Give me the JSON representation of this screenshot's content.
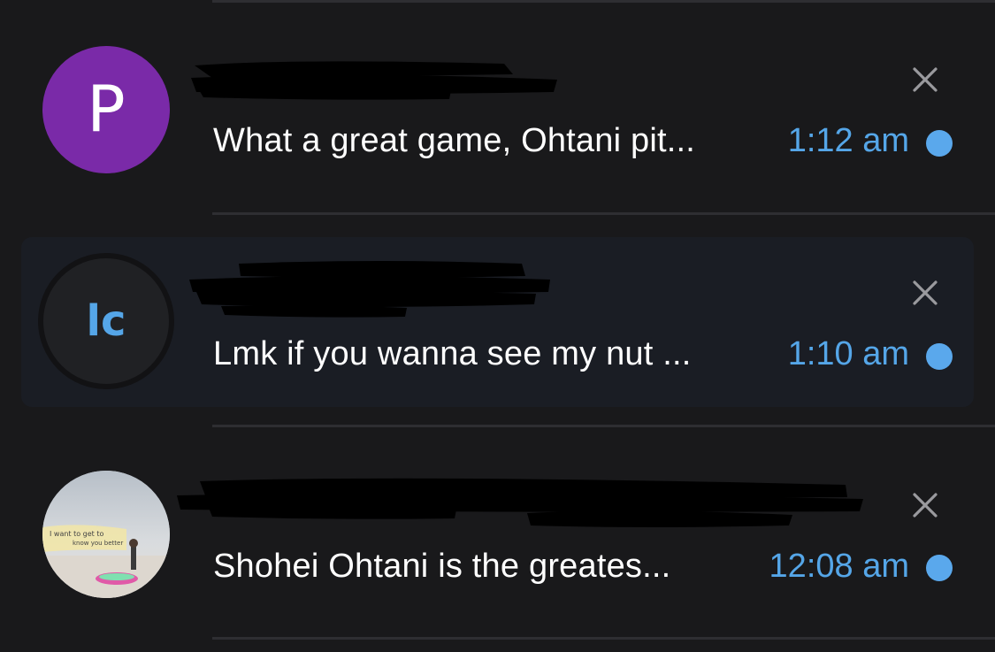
{
  "colors": {
    "background": "#19191b",
    "selected_row": "#1a1d24",
    "accent_blue": "#55a6e8",
    "unread_dot": "#5aa8ec",
    "divider": "#2e2e32",
    "close_icon": "#9a9a9e"
  },
  "conversations": [
    {
      "avatar_letter": "P",
      "avatar_color": "#7a2aa8",
      "name_redacted": true,
      "message": "What a great game, Ohtani pit...",
      "time": "1:12 am",
      "unread": true,
      "close_icon": "close-icon"
    },
    {
      "avatar_letter": "lc",
      "avatar_color": "#202124",
      "name_redacted": true,
      "message": "Lmk if you wanna see my nut ...",
      "time": "1:10 am",
      "unread": true,
      "selected": true,
      "close_icon": "close-icon"
    },
    {
      "avatar_image": "photo-avatar",
      "avatar_image_text": "I want to get to know you better",
      "name_redacted": true,
      "message": "Shohei Ohtani is the greates...",
      "time": "12:08 am",
      "unread": true,
      "close_icon": "close-icon"
    }
  ]
}
